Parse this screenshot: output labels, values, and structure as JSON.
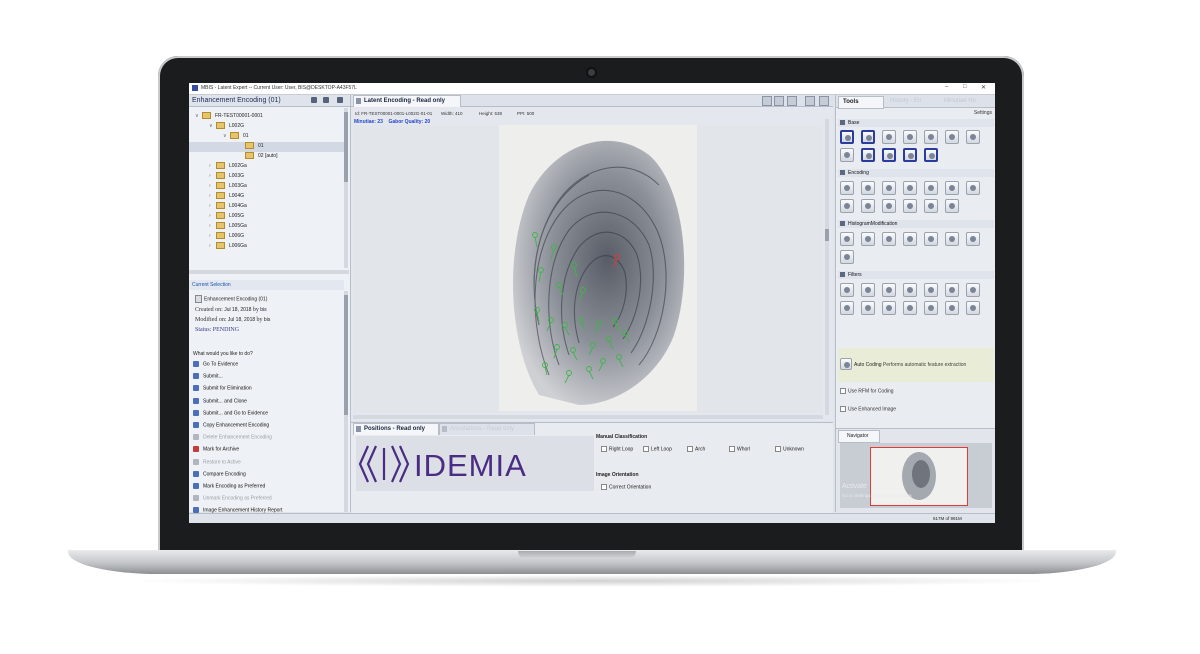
{
  "window": {
    "title": "MBIS - Latent Expert -- Current User: User, BIS@DESKTOP-A43F57L",
    "controls": [
      "–",
      "□",
      "✕"
    ]
  },
  "left_pane": {
    "title": "Enhancement Encoding (01)",
    "tree": [
      {
        "label": "FR-TEST00001-0001",
        "level": 1,
        "arrow": "∨"
      },
      {
        "label": "L002G",
        "level": 2,
        "arrow": "∨"
      },
      {
        "label": "01",
        "level": 3,
        "arrow": "∨"
      },
      {
        "label": "01",
        "level": 4,
        "arrow": "",
        "selected": true
      },
      {
        "label": "02 [auto]",
        "level": 4,
        "arrow": ""
      },
      {
        "label": "L002Ga",
        "level": 2,
        "arrow": "›"
      },
      {
        "label": "L003G",
        "level": 2,
        "arrow": "›"
      },
      {
        "label": "L003Ga",
        "level": 2,
        "arrow": "›"
      },
      {
        "label": "L004G",
        "level": 2,
        "arrow": "›"
      },
      {
        "label": "L004Ga",
        "level": 2,
        "arrow": "›"
      },
      {
        "label": "L005G",
        "level": 2,
        "arrow": "›"
      },
      {
        "label": "L005Ga",
        "level": 2,
        "arrow": "›"
      },
      {
        "label": "L006G",
        "level": 2,
        "arrow": "›"
      },
      {
        "label": "L006Ga",
        "level": 2,
        "arrow": "›"
      }
    ],
    "current_selection_label": "Current Selection",
    "selection_name": "Enhancement Encoding (01)",
    "created_label": "Created on:",
    "created_value": "Jul 18, 2018",
    "created_by_label": "by",
    "created_by": "bis",
    "modified_label": "Modified on:",
    "modified_value": "Jul 18, 2018",
    "modified_by_label": "by",
    "modified_by": "bis",
    "status_label": "Status:",
    "status_value": "PENDING",
    "question": "What would you like to do?",
    "actions": [
      {
        "label": "Go To Evidence",
        "enabled": true,
        "color": "#4a6fb8"
      },
      {
        "label": "Submit...",
        "enabled": true,
        "color": "#4a6fb8"
      },
      {
        "label": "Submit for Elimination",
        "enabled": true,
        "color": "#4a6fb8"
      },
      {
        "label": "Submit... and Clone",
        "enabled": true,
        "color": "#4a6fb8"
      },
      {
        "label": "Submit... and Go to Evidence",
        "enabled": true,
        "color": "#4a6fb8"
      },
      {
        "label": "Copy Enhancement Encoding",
        "enabled": true,
        "color": "#4a6fb8"
      },
      {
        "label": "Delete Enhancement Encoding",
        "enabled": false,
        "color": "#b0b5be"
      },
      {
        "label": "Mark for Archive",
        "enabled": true,
        "color": "#c43b3b"
      },
      {
        "label": "Restore to Active",
        "enabled": false,
        "color": "#b0b5be"
      },
      {
        "label": "Compare Encoding",
        "enabled": true,
        "color": "#4a6fb8"
      },
      {
        "label": "Mark Encoding as Preferred",
        "enabled": true,
        "color": "#4a6fb8"
      },
      {
        "label": "Unmark Encoding as Preferred",
        "enabled": false,
        "color": "#b0b5be"
      },
      {
        "label": "Image Enhancement History Report",
        "enabled": true,
        "color": "#4a6fb8"
      }
    ]
  },
  "center": {
    "tab_title": "Latent Encoding - Read only",
    "id_label": "Id: FR-TEST00001-0001-L002G-01-01",
    "width_label": "Width: 410",
    "height_label": "Height: 538",
    "ppi_label": "PPI: 500",
    "minutiae_label": "Minutiae: 23",
    "quality_label": "Gabor Quality: 20"
  },
  "positions": {
    "tab_title": "Positions - Read only",
    "tab2_title": "Annotations - Read only",
    "brand": "IDEMIA",
    "manual_classification": "Manual Classification",
    "classes": [
      "Right Loop",
      "Left Loop",
      "Arch",
      "Whorl",
      "Unknown"
    ],
    "image_orientation": "Image Orientation",
    "correct_orientation": "Correct Orientation"
  },
  "right_pane": {
    "tab_tools": "Tools",
    "tab_history": "History - En",
    "tab_minutiae": "Minutiae Ho",
    "settings": "Settings",
    "groups": [
      "Base",
      "Encoding",
      "HistogramModification",
      "Filters"
    ],
    "auto_coding_label": "Auto Coding",
    "auto_coding_desc": "Performs automatic feature extraction",
    "use_rfm": "Use RFM for Coding",
    "use_enhanced": "Use Enhanced Image",
    "navigator": "Navigator",
    "watermark1": "Activate",
    "watermark2": "Go to Settings to activate Windows"
  },
  "status_bar": {
    "memory": "617M of 991M"
  }
}
